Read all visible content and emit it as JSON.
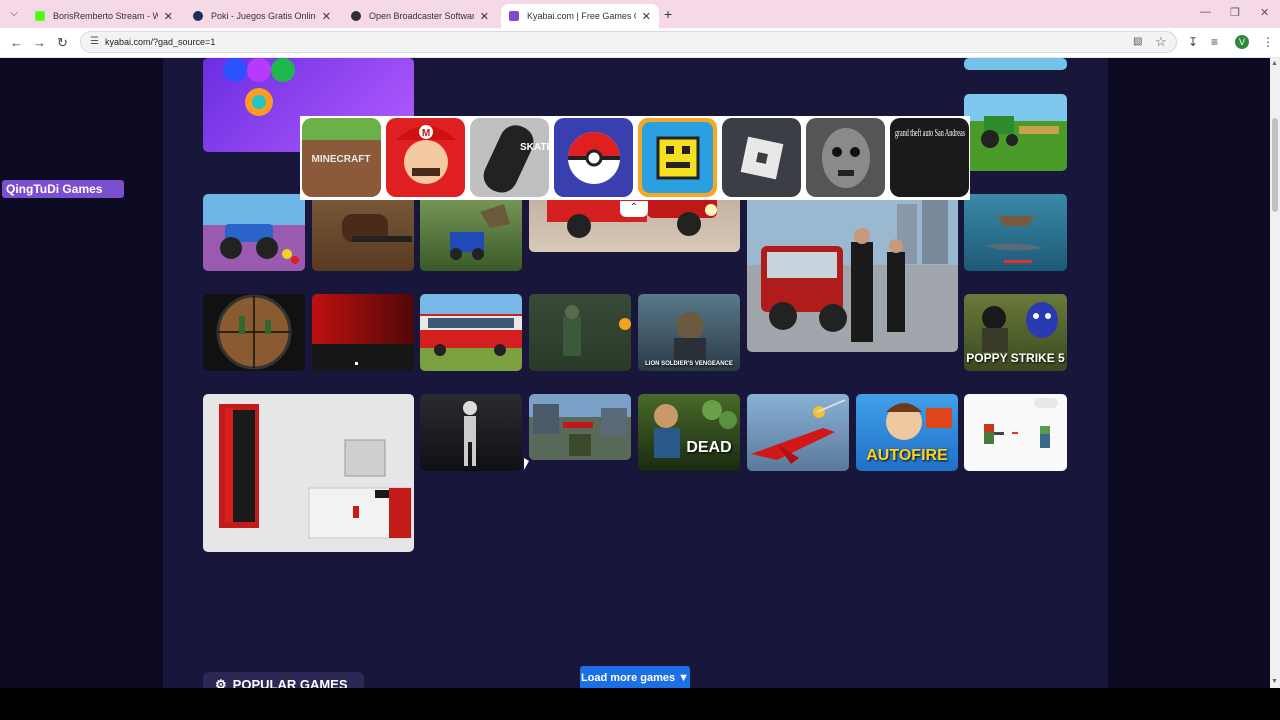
{
  "browser": {
    "tabs": [
      {
        "title": "BorisRemberto Stream - Watch",
        "favicon_color": "#53fc18"
      },
      {
        "title": "Poki - Juegos Gratis Online - ju",
        "favicon_color": "#1f2d5c"
      },
      {
        "title": "Open Broadcaster Software | O",
        "favicon_color": "#302e31"
      },
      {
        "title": "Kyabai.com | Free Games Online",
        "favicon_color": "#7a4fd0"
      }
    ],
    "url": "kyabai.com/?gad_source=1"
  },
  "ad": {
    "label": "QingTuDi Games",
    "items": [
      {
        "name": "minecraft",
        "text": "MINECRAFT",
        "color": "#5b9b3c"
      },
      {
        "name": "mario",
        "text": "M",
        "color": "#e02020"
      },
      {
        "name": "skate",
        "text": "SKATE",
        "color": "#c0c0c0"
      },
      {
        "name": "pokeball",
        "text": "",
        "color": "#3a3fb0"
      },
      {
        "name": "geometry-dash",
        "text": "",
        "color": "#f5a623"
      },
      {
        "name": "roblox",
        "text": "",
        "color": "#3b3f45"
      },
      {
        "name": "granny",
        "text": "",
        "color": "#555555"
      },
      {
        "name": "gta-san-andreas",
        "text": "grand theft auto San Andreas",
        "color": "#1a1a1a"
      }
    ]
  },
  "games": {
    "poppy_strike": "POPPY STRIKE 5",
    "dead_ahead": "DEAD",
    "mr_autofire": "AUTOFIRE",
    "lion_soldier": "LION SOLDIER'S VENGEANCE"
  },
  "actions": {
    "load_more": "Load more games",
    "popular": "POPULAR GAMES"
  }
}
